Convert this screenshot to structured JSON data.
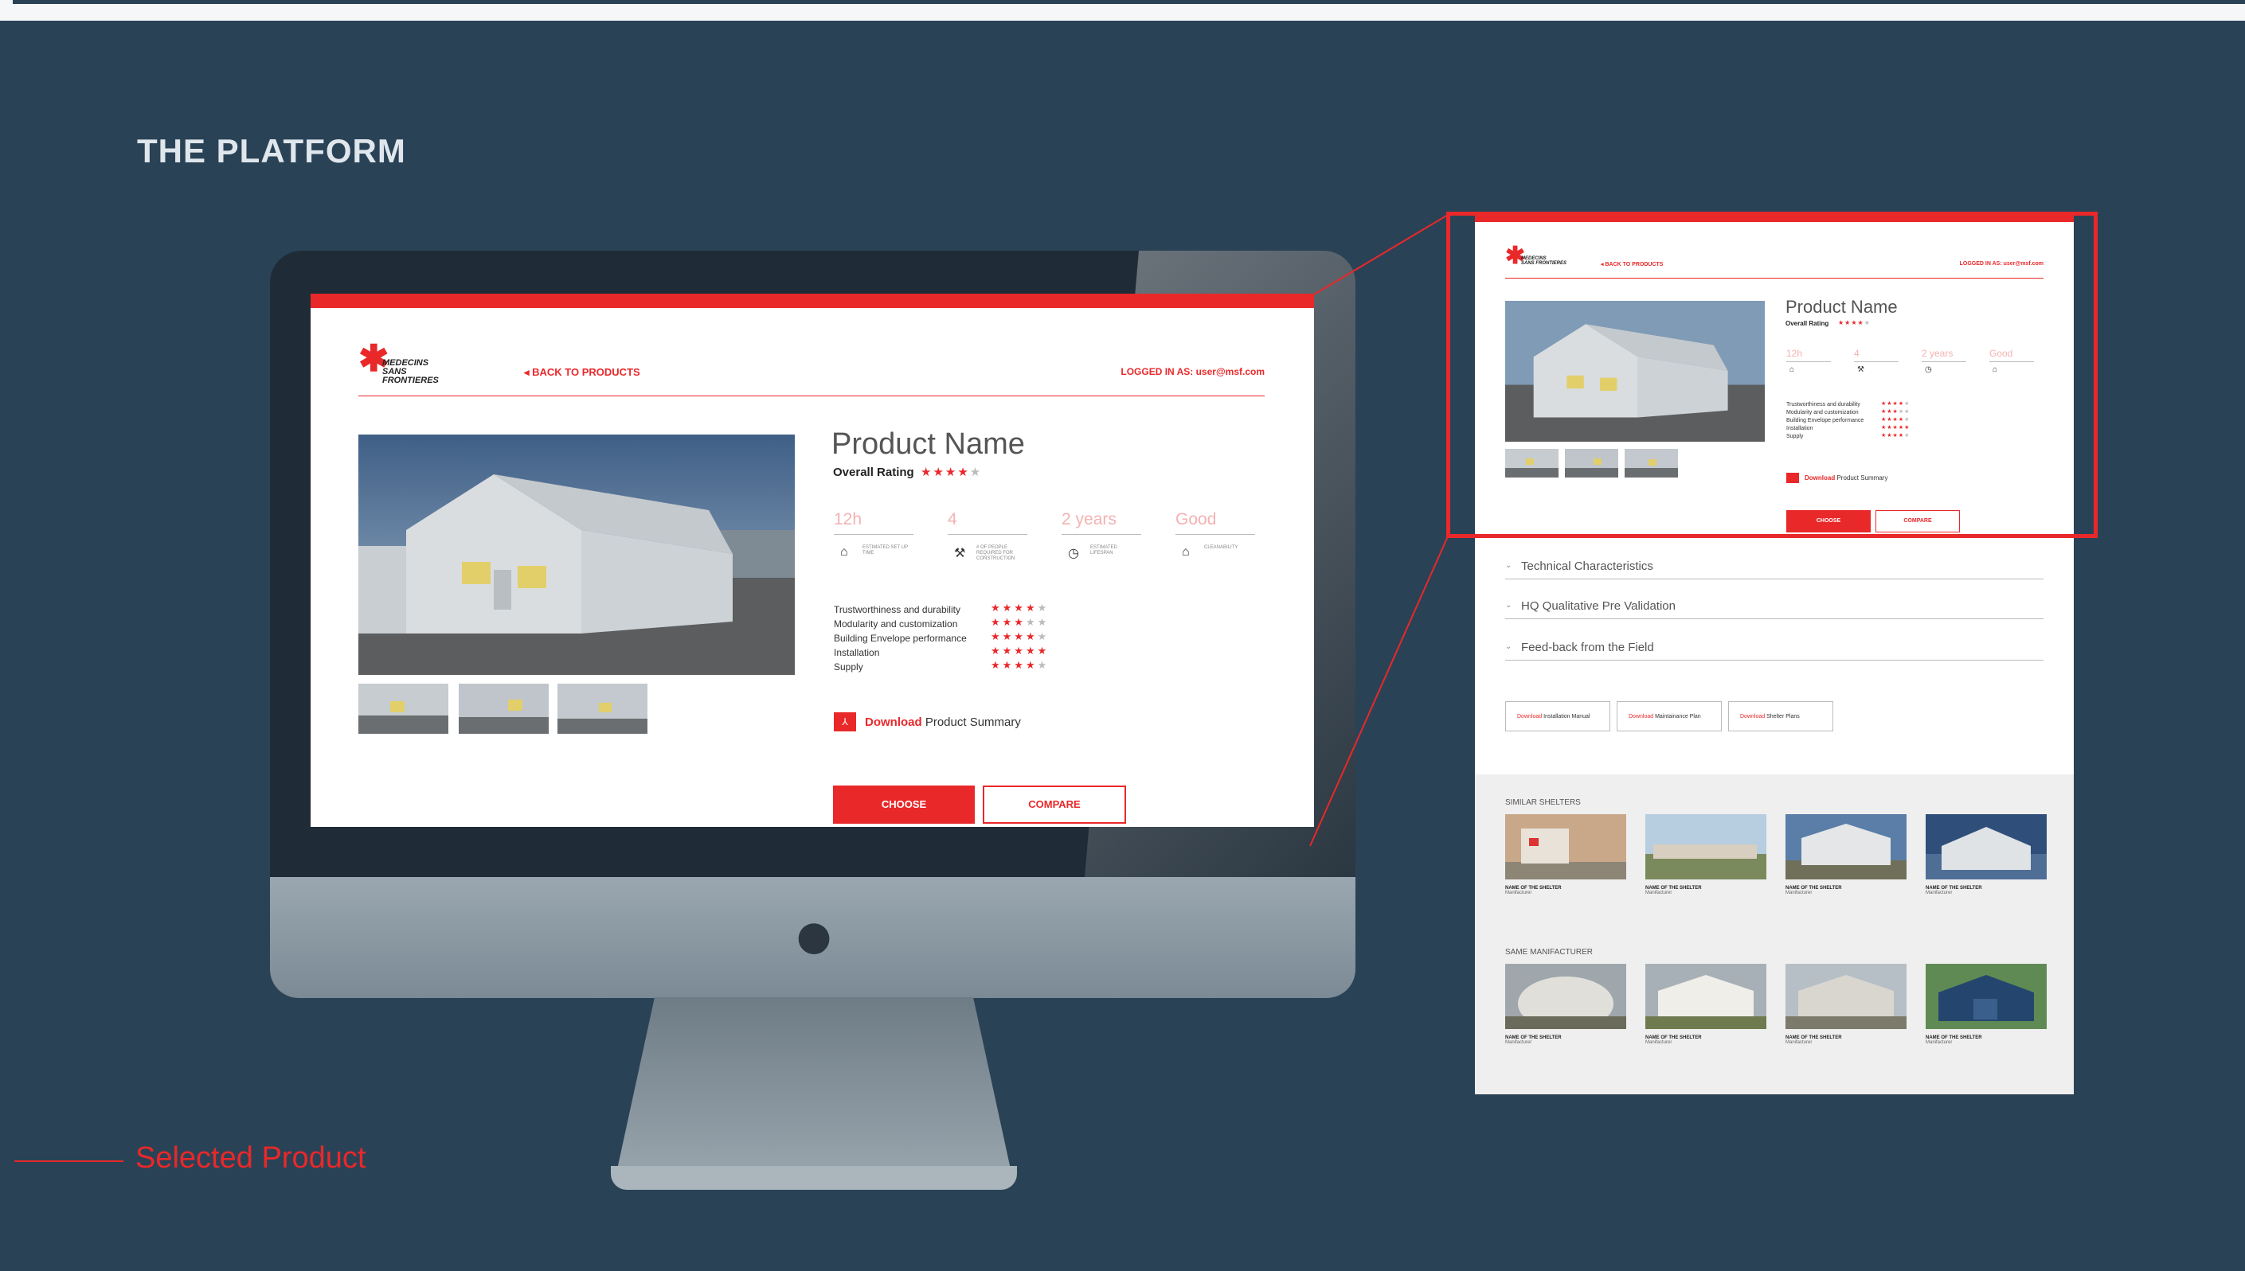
{
  "slide": {
    "heading": "THE PLATFORM",
    "footer_label": "Selected Product"
  },
  "colors": {
    "accent": "#e9282a",
    "background": "#2a4256",
    "muted_value": "#f3b2b2"
  },
  "header": {
    "logo_text_1": "MEDECINS",
    "logo_text_2": "SANS FRONTIERES",
    "back_label": "BACK TO PRODUCTS",
    "logged_in": "LOGGED IN AS: user@msf.com"
  },
  "product": {
    "name": "Product Name",
    "rating_label": "Overall Rating",
    "rating": 4,
    "rating_max": 5,
    "metrics": [
      {
        "value": "12h",
        "label": "ESTIMATED SET UP TIME",
        "icon": "clock-house-icon"
      },
      {
        "value": "4",
        "label": "# OF PEOPLE REQUIRED FOR CONSTRUCTION",
        "icon": "people-tools-icon"
      },
      {
        "value": "2 years",
        "label": "ESTIMATED LIFESPAN",
        "icon": "lifespan-clock-icon"
      },
      {
        "value": "Good",
        "label": "CLEANABILITY",
        "icon": "house-clean-icon"
      }
    ],
    "criteria": [
      {
        "label": "Trustworthiness and durability",
        "stars": 4
      },
      {
        "label": "Modularity and customization",
        "stars": 3
      },
      {
        "label": "Building Envelope performance",
        "stars": 4
      },
      {
        "label": "Installation",
        "stars": 5
      },
      {
        "label": "Supply",
        "stars": 4
      }
    ],
    "download_word": "Download",
    "download_rest": "Product Summary",
    "choose_label": "CHOOSE",
    "compare_label": "COMPARE"
  },
  "detail": {
    "accordions": [
      "Technical Characteristics",
      "HQ Qualitative Pre Validation",
      "Feed-back from the Field"
    ],
    "downloads": [
      {
        "word": "Download",
        "rest": "Installation Manual"
      },
      {
        "word": "Download",
        "rest": "Maintainance Plan"
      },
      {
        "word": "Download",
        "rest": "Shelter Plans"
      }
    ],
    "similar_title": "SIMILAR SHELTERS",
    "manufacturer_title": "SAME MANIFACTURER",
    "card_name": "NAME OF THE SHELTER",
    "card_manufacturer": "Manifacturer"
  }
}
